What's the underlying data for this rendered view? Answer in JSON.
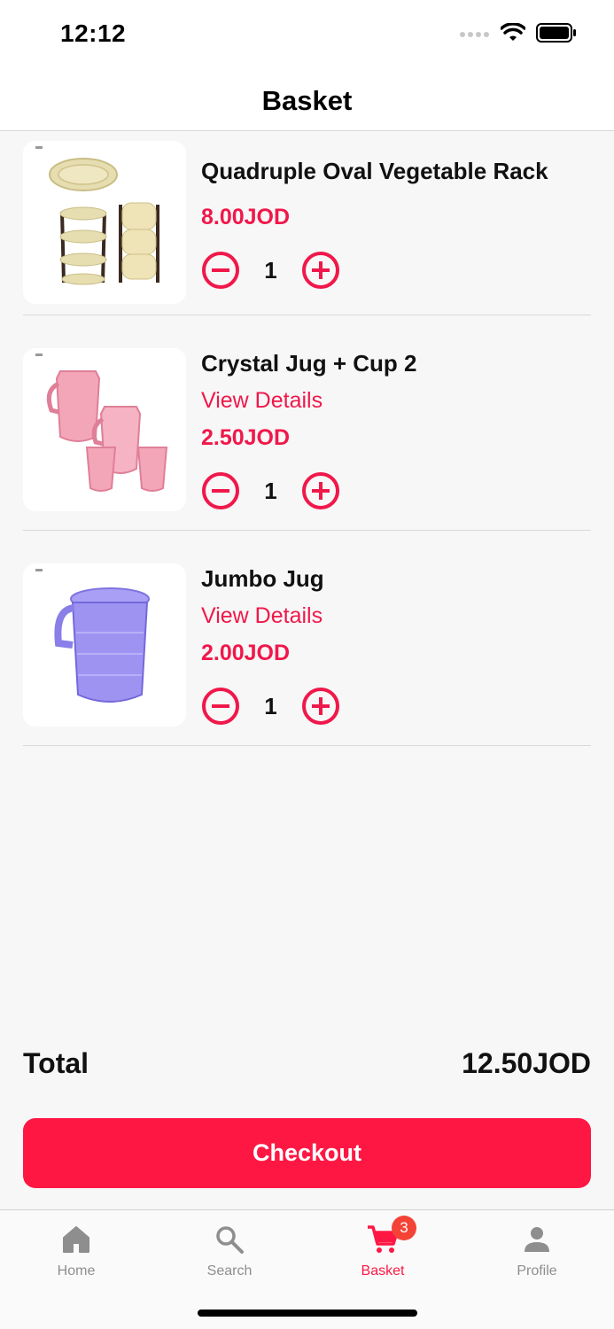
{
  "status": {
    "time": "12:12"
  },
  "header": {
    "title": "Basket"
  },
  "items": [
    {
      "name": "Quadruple Oval Vegetable Rack",
      "view_details": "",
      "price": "8.00JOD",
      "quantity": "1"
    },
    {
      "name": "Crystal Jug + Cup 2",
      "view_details": "View Details",
      "price": "2.50JOD",
      "quantity": "1"
    },
    {
      "name": "Jumbo Jug",
      "view_details": "View Details",
      "price": "2.00JOD",
      "quantity": "1"
    }
  ],
  "summary": {
    "total_label": "Total",
    "total_value": "12.50JOD"
  },
  "checkout": {
    "label": "Checkout"
  },
  "tabs": [
    {
      "label": "Home",
      "icon": "home-icon"
    },
    {
      "label": "Search",
      "icon": "search-icon"
    },
    {
      "label": "Basket",
      "icon": "cart-icon",
      "badge": "3",
      "active": true
    },
    {
      "label": "Profile",
      "icon": "person-icon"
    }
  ],
  "colors": {
    "accent": "#ff1744",
    "price": "#f0184a",
    "badge": "#f44336",
    "inactive_tab": "#8e8e8e"
  }
}
